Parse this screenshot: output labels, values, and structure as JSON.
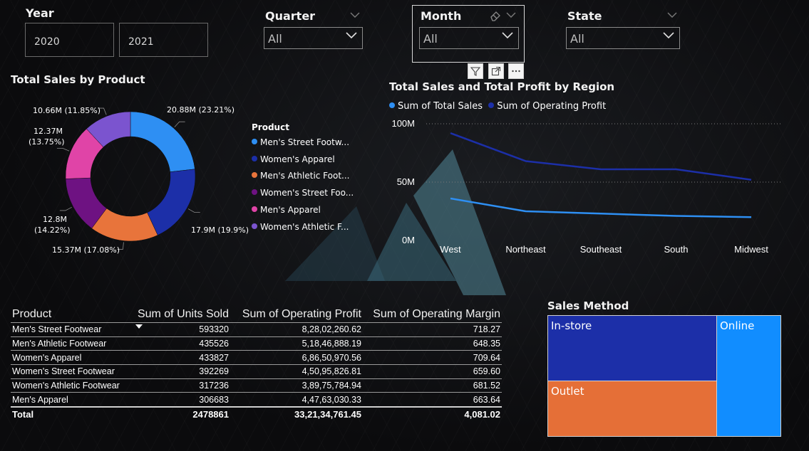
{
  "slicers": {
    "year": {
      "title": "Year",
      "options": [
        "2020",
        "2021"
      ]
    },
    "quarter": {
      "title": "Quarter",
      "value": "All"
    },
    "month": {
      "title": "Month",
      "value": "All"
    },
    "state": {
      "title": "State",
      "value": "All"
    }
  },
  "visual_header_icons": [
    "filter-icon",
    "focus-mode-icon",
    "more-options-icon"
  ],
  "donut": {
    "title": "Total Sales by Product",
    "legend_title": "Product",
    "legend": [
      {
        "label": "Men's Street Footw...",
        "color": "#2e8ff3"
      },
      {
        "label": "Women's Apparel",
        "color": "#1c2fa8"
      },
      {
        "label": "Men's Athletic Foot...",
        "color": "#e8743b"
      },
      {
        "label": "Women's Street Foo...",
        "color": "#6e1282"
      },
      {
        "label": "Men's Apparel",
        "color": "#e044a7"
      },
      {
        "label": "Women's Athletic F...",
        "color": "#7b54cf"
      }
    ],
    "labels": {
      "mens_street": "20.88M (23.21%)",
      "womens_apparel": "17.9M (19.9%)",
      "mens_athletic": "15.37M (17.08%)",
      "womens_street_1": "12.8M",
      "womens_street_2": "(14.22%)",
      "mens_apparel_1": "12.37M",
      "mens_apparel_2": "(13.75%)",
      "womens_athletic": "10.66M (11.85%)"
    }
  },
  "line": {
    "title": "Total Sales and Total Profit by Region",
    "legend": [
      {
        "label": "Sum of Total Sales",
        "color": "#2e8ff3"
      },
      {
        "label": "Sum of Operating Profit",
        "color": "#1c2fa8"
      }
    ],
    "y_ticks": [
      "100M",
      "50M",
      "0M"
    ]
  },
  "table": {
    "headers": [
      "Product",
      "Sum of Units Sold",
      "Sum of Operating Profit",
      "Sum of Operating Margin"
    ],
    "rows": [
      [
        "Men's Street Footwear",
        "593320",
        "8,28,02,260.62",
        "718.27"
      ],
      [
        "Men's Athletic Footwear",
        "435526",
        "5,18,46,888.19",
        "648.35"
      ],
      [
        "Women's Apparel",
        "433827",
        "6,86,50,970.56",
        "709.64"
      ],
      [
        "Women's Street Footwear",
        "392269",
        "4,50,95,826.81",
        "659.60"
      ],
      [
        "Women's Athletic Footwear",
        "317236",
        "3,89,75,784.94",
        "681.52"
      ],
      [
        "Men's Apparel",
        "306683",
        "4,47,63,030.33",
        "663.64"
      ]
    ],
    "total": [
      "Total",
      "2478861",
      "33,21,34,761.45",
      "4,081.02"
    ]
  },
  "treemap": {
    "title": "Sales Method",
    "cells": [
      {
        "label": "In-store",
        "color": "#1c2fa8"
      },
      {
        "label": "Outlet",
        "color": "#e56f37"
      },
      {
        "label": "Online",
        "color": "#118dff"
      }
    ]
  },
  "chart_data": [
    {
      "type": "pie",
      "title": "Total Sales by Product",
      "categories": [
        "Men's Street Footwear",
        "Women's Apparel",
        "Men's Athletic Footwear",
        "Women's Street Footwear",
        "Men's Apparel",
        "Women's Athletic Footwear"
      ],
      "values": [
        20.88,
        17.9,
        15.37,
        12.8,
        12.37,
        10.66
      ],
      "percent": [
        23.21,
        19.9,
        17.08,
        14.22,
        13.75,
        11.85
      ],
      "colors": [
        "#2e8ff3",
        "#1c2fa8",
        "#e8743b",
        "#6e1282",
        "#e044a7",
        "#7b54cf"
      ],
      "donut": true,
      "legend": "right"
    },
    {
      "type": "line",
      "title": "Total Sales and Total Profit by Region",
      "categories": [
        "West",
        "Northeast",
        "Southeast",
        "South",
        "Midwest"
      ],
      "series": [
        {
          "name": "Sum of Operating Profit",
          "values": [
            92,
            68,
            61,
            61,
            52
          ],
          "color": "#1c2fa8"
        },
        {
          "name": "Sum of Total Sales",
          "values": [
            36,
            25,
            23,
            21,
            20
          ],
          "color": "#2e8ff3"
        }
      ],
      "ylim": [
        0,
        100
      ],
      "grid": true,
      "legend": "top-left"
    }
  ]
}
